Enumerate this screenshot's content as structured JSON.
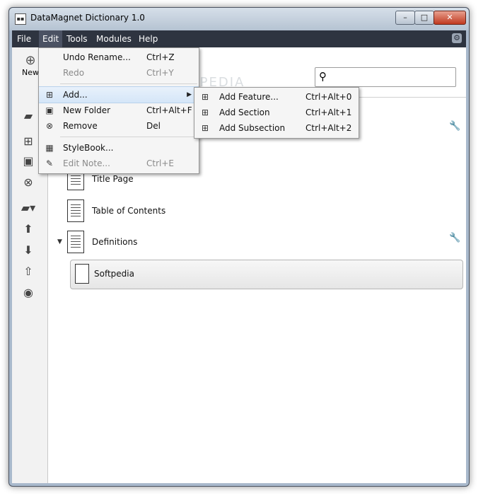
{
  "window": {
    "title": "DataMagnet Dictionary 1.0",
    "min_glyph": "–",
    "max_glyph": "□",
    "close_glyph": "✕"
  },
  "menubar": {
    "items": [
      "File",
      "Edit",
      "Tools",
      "Modules",
      "Help"
    ],
    "active": "Edit"
  },
  "toolbar": {
    "new_label": "New",
    "search_value": ""
  },
  "watermark": "SOFTPEDIA",
  "edit_menu": {
    "items": [
      {
        "label": "Undo Rename...",
        "shortcut": "Ctrl+Z",
        "disabled": false
      },
      {
        "label": "Redo",
        "shortcut": "Ctrl+Y",
        "disabled": true
      },
      {
        "label": "Add...",
        "shortcut": "",
        "disabled": false,
        "submenu": true
      },
      {
        "label": "New Folder",
        "shortcut": "Ctrl+Alt+F",
        "disabled": false
      },
      {
        "label": "Remove",
        "shortcut": "Del",
        "disabled": false
      },
      {
        "label": "StyleBook...",
        "shortcut": "",
        "disabled": false
      },
      {
        "label": "Edit Note...",
        "shortcut": "Ctrl+E",
        "disabled": true
      }
    ]
  },
  "add_submenu": {
    "items": [
      {
        "label": "Add Feature...",
        "shortcut": "Ctrl+Alt+0"
      },
      {
        "label": "Add Section",
        "shortcut": "Ctrl+Alt+1"
      },
      {
        "label": "Add Subsection",
        "shortcut": "Ctrl+Alt+2"
      }
    ]
  },
  "tree": {
    "title_page": "Title Page",
    "toc": "Table of Contents",
    "definitions": "Definitions",
    "selected": "Softpedia"
  }
}
